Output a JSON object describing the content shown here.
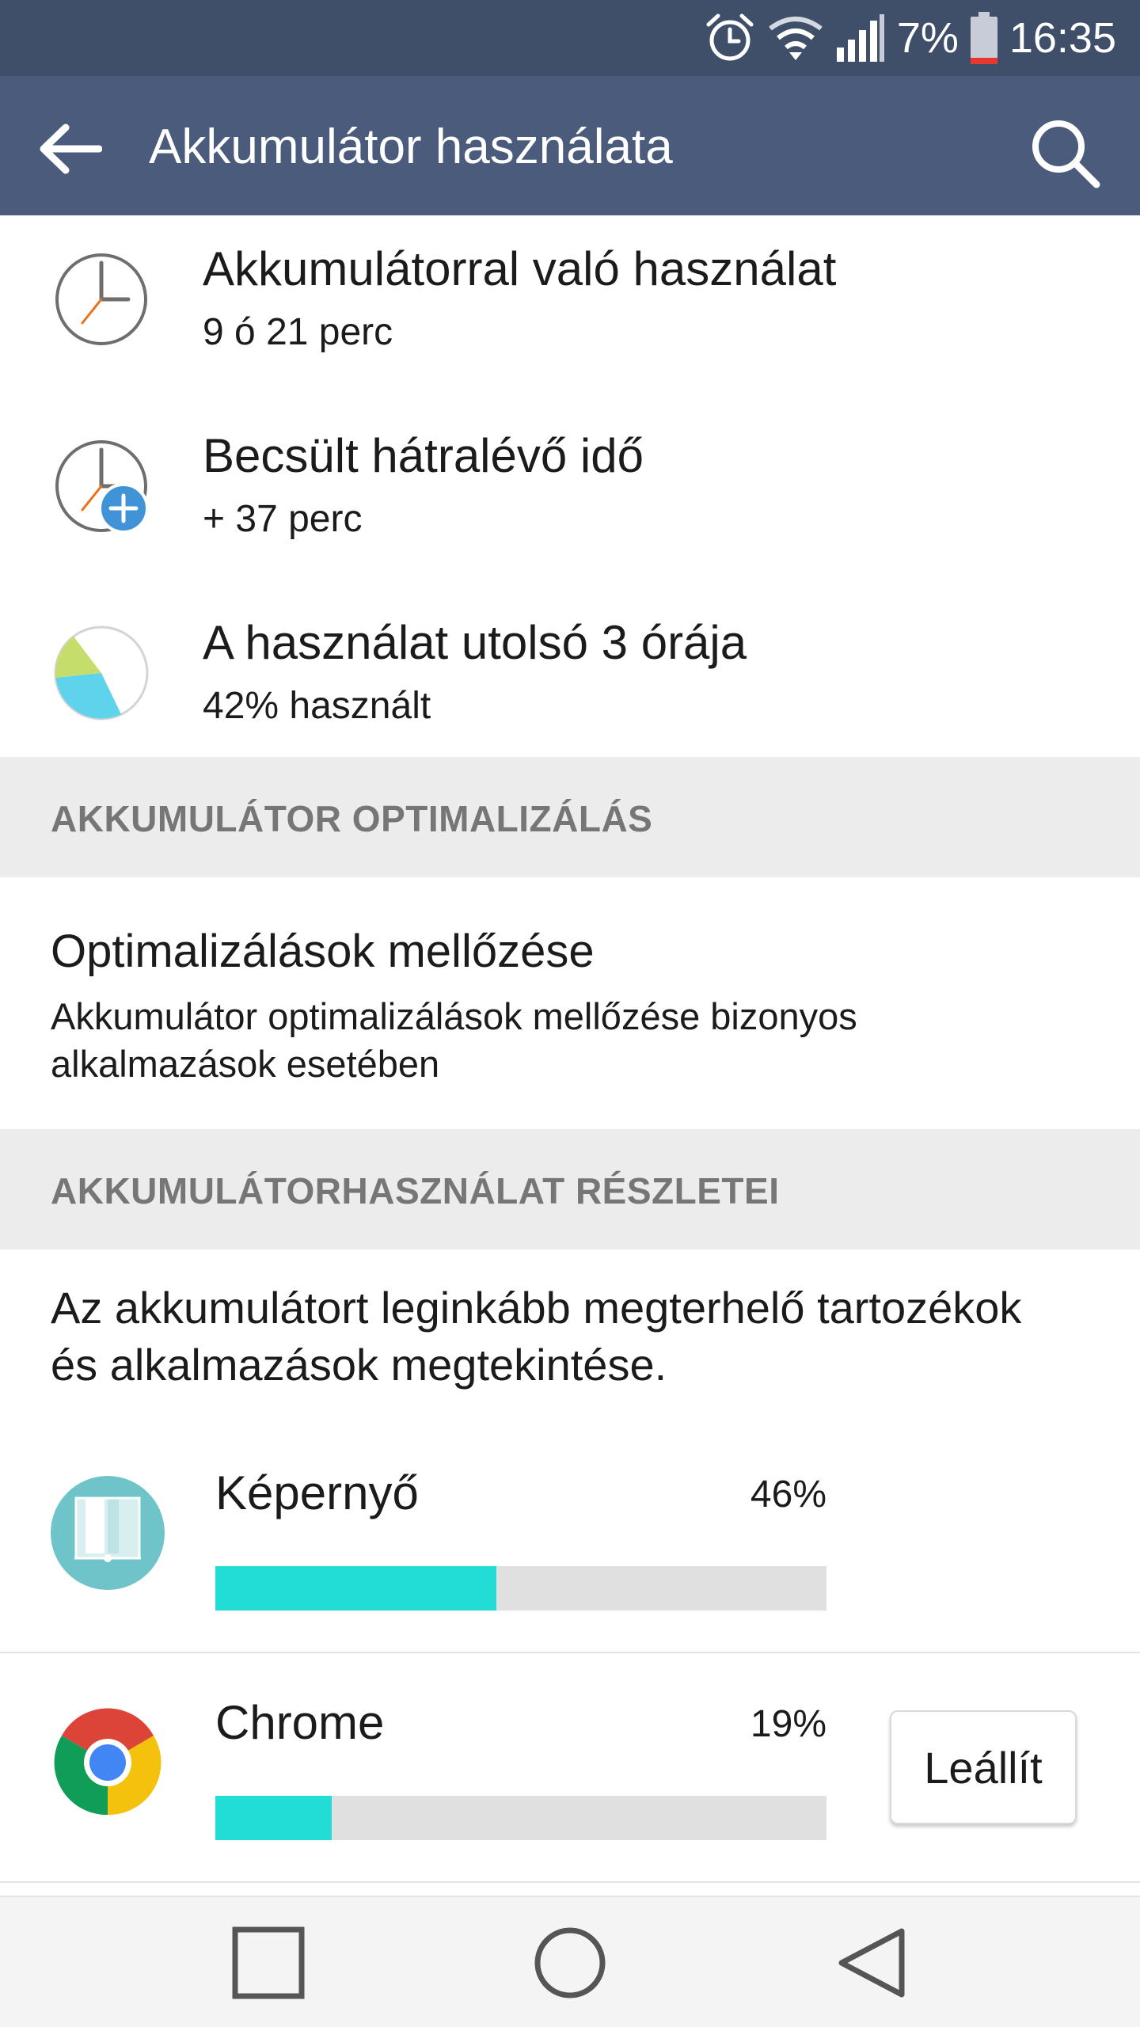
{
  "status_bar": {
    "battery_percent": "7%",
    "time": "16:35",
    "icons": [
      "alarm-icon",
      "wifi-icon",
      "signal-icon",
      "battery-icon"
    ]
  },
  "app_bar": {
    "title": "Akkumulátor használata",
    "back_icon": "arrow-back-icon",
    "search_icon": "search-icon"
  },
  "summary": [
    {
      "title": "Akkumulátorral való használat",
      "subtitle": "9 ó 21 perc",
      "icon": "clock-icon"
    },
    {
      "title": "Becsült hátralévő idő",
      "subtitle": "+ 37 perc",
      "icon": "clock-plus-icon"
    },
    {
      "title": "A használat utolsó 3 órája",
      "subtitle": "42% használt",
      "icon": "pie-chart-icon"
    }
  ],
  "optimization_section": {
    "header": "AKKUMULÁTOR OPTIMALIZÁLÁS",
    "item_title": "Optimalizálások mellőzése",
    "item_description": "Akkumulátor optimalizálások mellőzése bizonyos alkalmazások esetében"
  },
  "details_section": {
    "header": "AKKUMULÁTORHASZNÁLAT RÉSZLETEI",
    "intro": "Az akkumulátort leginkább megterhelő tartozékok és alkalmazások megtekintése."
  },
  "usage_items": [
    {
      "name": "Képernyő",
      "percent_label": "46%",
      "fraction": 0.46,
      "icon": "screen-icon"
    },
    {
      "name": "Chrome",
      "percent_label": "19%",
      "fraction": 0.19,
      "icon": "chrome-icon",
      "action_label": "Leállít"
    }
  ],
  "colors": {
    "status_bar": "#3f4e69",
    "app_bar": "#4a5b7c",
    "section_header_bg": "#ececec",
    "section_header_text": "#767676",
    "usage_bar_fill": "#22dcd6",
    "usage_bar_track": "#e0e0e0",
    "clock_accent": "#e8721c",
    "plus_badge": "#3f93d6"
  },
  "nav_bar": {
    "buttons": [
      "recent-apps-icon",
      "home-icon",
      "back-icon"
    ]
  }
}
